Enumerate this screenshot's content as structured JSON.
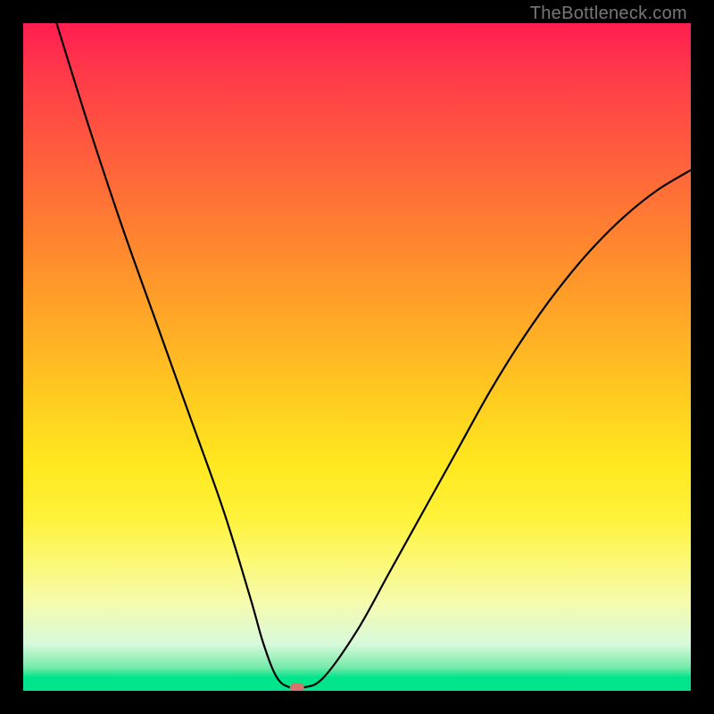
{
  "watermark": "TheBottleneck.com",
  "chart_data": {
    "type": "line",
    "title": "",
    "xlabel": "",
    "ylabel": "",
    "xlim": [
      0,
      100
    ],
    "ylim": [
      0,
      100
    ],
    "grid": false,
    "legend": false,
    "series": [
      {
        "name": "curve",
        "x": [
          5,
          10,
          15,
          20,
          25,
          30,
          34,
          36,
          38,
          40,
          42,
          45,
          50,
          55,
          60,
          65,
          70,
          75,
          80,
          85,
          90,
          95,
          100
        ],
        "y": [
          100,
          84,
          69,
          55,
          41,
          27,
          14,
          7,
          2,
          0.5,
          0.5,
          2,
          9,
          18,
          27,
          36,
          45,
          53,
          60,
          66,
          71,
          75,
          78
        ]
      }
    ],
    "marker": {
      "x": 41,
      "y": 0.5,
      "shape": "rounded-rect",
      "color": "#d6746e"
    },
    "background_gradient": {
      "orientation": "vertical",
      "stops": [
        {
          "pos": 0.0,
          "color": "#ff1e50"
        },
        {
          "pos": 0.5,
          "color": "#ffcb20"
        },
        {
          "pos": 0.8,
          "color": "#fcf86f"
        },
        {
          "pos": 0.97,
          "color": "#76eaa9"
        },
        {
          "pos": 1.0,
          "color": "#00e58b"
        }
      ]
    }
  }
}
